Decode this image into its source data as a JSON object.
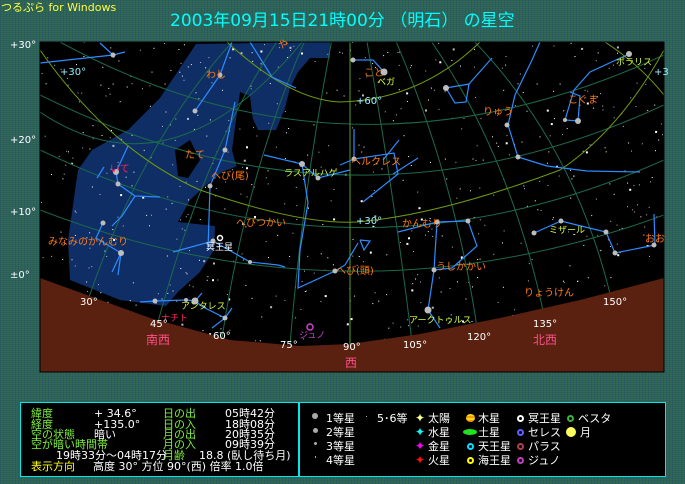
{
  "app_title": "つるぷら for Windows",
  "view_title": "2003年09月15日21時00分 （明石） の星空",
  "colors": {
    "sky": "#000000",
    "ground": "#5a2010",
    "milky_way": "#0f2e66",
    "const_line": "#2d8cff",
    "alt_line": "#6f9a10",
    "az_line": "#1c6a4a",
    "const_label": "#ff7a10",
    "star_name": "#d8ff40",
    "direction": "#ff4f8a"
  },
  "declination_labels": [
    "+30°",
    "+20°",
    "+10°",
    "±0°"
  ],
  "grid_labels": {
    "alt30_left": "+30°",
    "alt60": "+60°",
    "alt30_center": "+30°",
    "alt30_right": "+3"
  },
  "constellations": [
    "わし",
    "や",
    "たて",
    "いて",
    "へび(尾)",
    "こと",
    "りゅう",
    "こぐま",
    "ヘルクレス",
    "へびつかい",
    "みなみのかんむり",
    "へび(頭)",
    "かんむり",
    "うしかかい",
    "りょうけん",
    "おお"
  ],
  "star_names": [
    "ベガ",
    "ポラリス",
    "ラスアルハゲ",
    "アンタレス",
    "ミザール",
    "アークトゥルス"
  ],
  "objects": {
    "pluto": "冥王星",
    "juno": "ジュノ",
    "comet": "ナチト"
  },
  "azimuths": [
    "30°",
    "45°",
    "60°",
    "75°",
    "90°",
    "105°",
    "120°",
    "135°",
    "150°"
  ],
  "directions": [
    "南西",
    "西",
    "北西"
  ],
  "info": {
    "latitude_label": "緯度",
    "latitude": "+   34.6°",
    "longitude_label": "経度",
    "longitude": "+135.0°",
    "sky_state_label": "空の状態",
    "sky_state": "暗い",
    "dark_period_label": "空が暗い時間帯",
    "dark_period": "19時33分～04時17分",
    "sunrise_label": "日の出",
    "sunrise": "05時42分",
    "sunset_label": "日の入",
    "sunset": "18時08分",
    "moonrise_label": "月の出",
    "moonrise": "20時35分",
    "moonset_label": "月の入",
    "moonset": "09時39分",
    "moon_age_label": "月齢",
    "moon_age": "18.8 (臥し待ち月)",
    "view_dir_label": "表示方向",
    "view_dir": "高度 30°  方位 90°(西)  倍率 1.0倍"
  },
  "legend": {
    "mag1": "1等星",
    "mag2": "2等星",
    "mag3": "3等星",
    "mag4": "4等星",
    "mag56": "5･6等",
    "sun": "太陽",
    "mercury": "水星",
    "venus": "金星",
    "mars": "火星",
    "jupiter": "木星",
    "saturn": "土星",
    "uranus": "天王星",
    "neptune": "海王星",
    "pluto": "冥王星",
    "ceres": "セレス",
    "pallas": "パラス",
    "juno": "ジュノ",
    "vesta": "ベスタ",
    "moon": "月"
  }
}
